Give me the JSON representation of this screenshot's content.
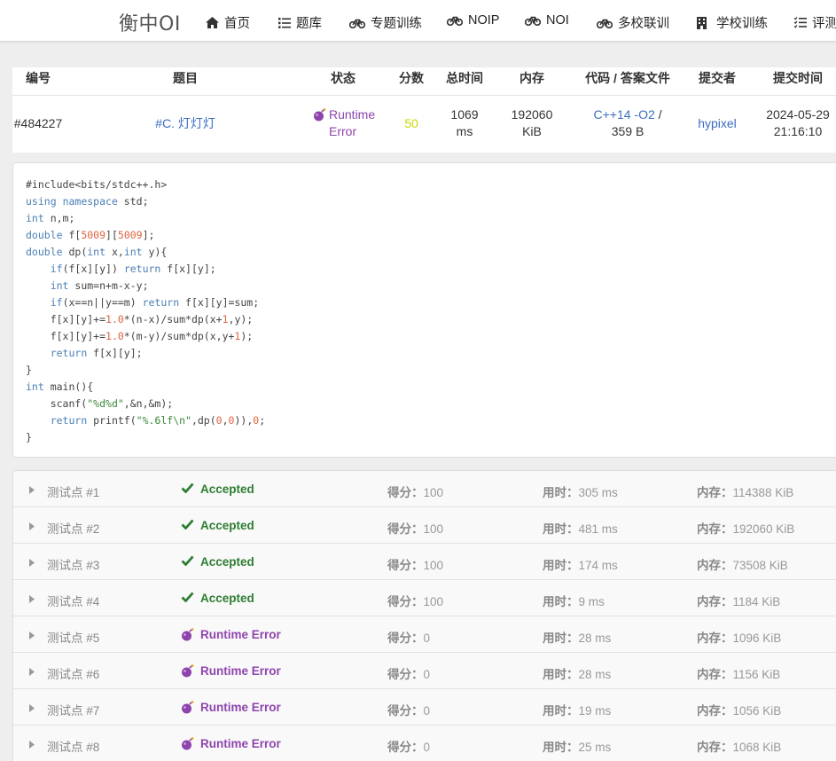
{
  "nav": {
    "brand": "衡中OI",
    "items": [
      "首页",
      "题库",
      "专题训练",
      "NOIP",
      "NOI",
      "多校联训",
      "学校训练",
      "评测"
    ]
  },
  "submission": {
    "headers": [
      "编号",
      "题目",
      "状态",
      "分数",
      "总时间",
      "内存",
      "代码 / 答案文件",
      "提交者",
      "提交时间"
    ],
    "id": "#484227",
    "problem": "#C. 灯灯灯",
    "status_line1": "Runtime",
    "status_line2": "Error",
    "score": "50",
    "time_line1": "1069",
    "time_line2": "ms",
    "memory_line1": "192060",
    "memory_line2": "KiB",
    "lang_line1": "C++14 -O2",
    "lang_sep": " /",
    "code_size": "359 B",
    "submitter": "hypixel",
    "date": "2024-05-29",
    "clock": "21:16:10"
  },
  "code_lines": [
    "#include<bits/stdc++.h>",
    "using namespace std;",
    "int n,m;",
    "double f[5009][5009];",
    "double dp(int x,int y){",
    "    if(f[x][y]) return f[x][y];",
    "    int sum=n+m-x-y;",
    "    if(x==n||y==m) return f[x][y]=sum;",
    "    f[x][y]+=1.0*(n-x)/sum*dp(x+1,y);",
    "    f[x][y]+=1.0*(m-y)/sum*dp(x,y+1);",
    "    return f[x][y];",
    "}",
    "int main(){",
    "    scanf(\"%d%d\",&n,&m);",
    "    return printf(\"%.6lf\\n\",dp(0,0)),0;",
    "}"
  ],
  "test_labels": {
    "score": "得分：",
    "time": "用时：",
    "memory": "内存："
  },
  "tests": [
    {
      "name": "测试点 #1",
      "status": "Accepted",
      "score": "100",
      "time": "305 ms",
      "memory": "114388 KiB"
    },
    {
      "name": "测试点 #2",
      "status": "Accepted",
      "score": "100",
      "time": "481 ms",
      "memory": "192060 KiB"
    },
    {
      "name": "测试点 #3",
      "status": "Accepted",
      "score": "100",
      "time": "174 ms",
      "memory": "73508 KiB"
    },
    {
      "name": "测试点 #4",
      "status": "Accepted",
      "score": "100",
      "time": "9 ms",
      "memory": "1184 KiB"
    },
    {
      "name": "测试点 #5",
      "status": "Runtime Error",
      "score": "0",
      "time": "28 ms",
      "memory": "1096 KiB"
    },
    {
      "name": "测试点 #6",
      "status": "Runtime Error",
      "score": "0",
      "time": "28 ms",
      "memory": "1156 KiB"
    },
    {
      "name": "测试点 #7",
      "status": "Runtime Error",
      "score": "0",
      "time": "19 ms",
      "memory": "1056 KiB"
    },
    {
      "name": "测试点 #8",
      "status": "Runtime Error",
      "score": "0",
      "time": "25 ms",
      "memory": "1068 KiB"
    }
  ],
  "colors": {
    "accepted": "#2e7d32",
    "runtime_error": "#8e44ad",
    "link": "#3b6dbf",
    "score_partial": "#c8d800"
  }
}
